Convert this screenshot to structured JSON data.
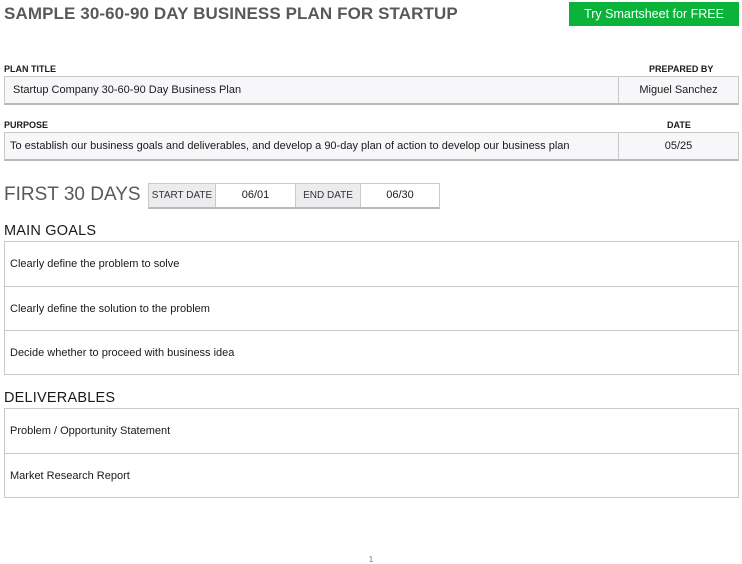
{
  "header": {
    "title": "SAMPLE 30-60-90 DAY BUSINESS PLAN FOR STARTUP",
    "cta_label": "Try Smartsheet for FREE"
  },
  "plan_info": {
    "plan_title_label": "PLAN TITLE",
    "plan_title_value": "Startup Company 30-60-90 Day Business Plan",
    "prepared_by_label": "PREPARED BY",
    "prepared_by_value": "Miguel Sanchez",
    "purpose_label": "PURPOSE",
    "purpose_value": "To establish our business goals and deliverables, and develop a 90-day plan of action to develop our business plan",
    "date_label": "DATE",
    "date_value": "05/25"
  },
  "period": {
    "heading": "FIRST 30 DAYS",
    "start_label": "START DATE",
    "start_value": "06/01",
    "end_label": "END DATE",
    "end_value": "06/30"
  },
  "main_goals": {
    "heading": "MAIN GOALS",
    "items": [
      "Clearly define the problem to solve",
      "Clearly define the solution to the problem",
      "Decide whether to proceed with business idea"
    ]
  },
  "deliverables": {
    "heading": "DELIVERABLES",
    "items": [
      "Problem / Opportunity Statement",
      "Market Research Report"
    ]
  },
  "footer": {
    "page_number": "1"
  }
}
